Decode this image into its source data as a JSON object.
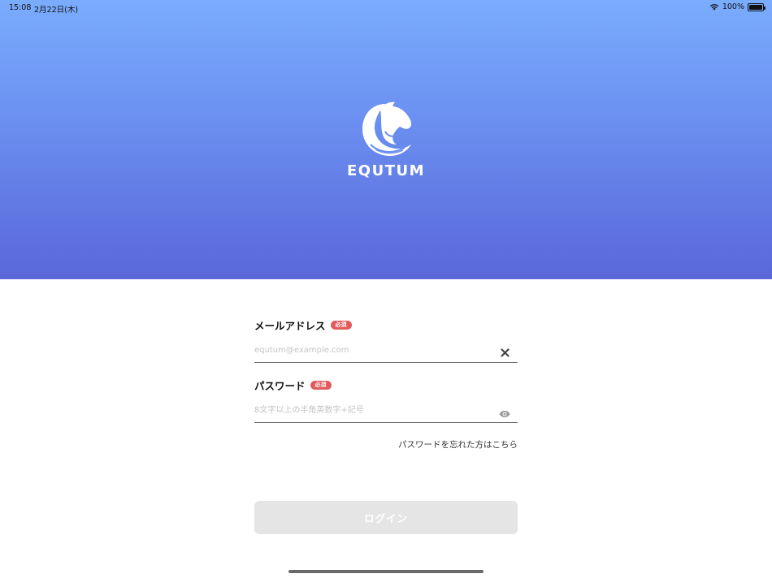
{
  "status_bar": {
    "time": "15:08",
    "date": "2月22日(木)",
    "battery": "100%"
  },
  "brand": {
    "name": "EQUTUM",
    "gradient_top": "#7aacfd",
    "gradient_bottom": "#5a67d8"
  },
  "form": {
    "email": {
      "label": "メールアドレス",
      "required": "必須",
      "placeholder": "equtum@example.com",
      "value": ""
    },
    "password": {
      "label": "パスワード",
      "required": "必須",
      "placeholder": "8文字以上の半角英数字+記号",
      "value": ""
    },
    "forgot_password": "パスワードを忘れた方はこちら",
    "login_label": "ログイン"
  },
  "icons": {
    "clear": "close-icon",
    "visibility": "eye-icon",
    "logo": "horse-head-icon"
  },
  "colors": {
    "required_badge": "#e15b5b",
    "login_disabled": "#e5e5e5"
  }
}
